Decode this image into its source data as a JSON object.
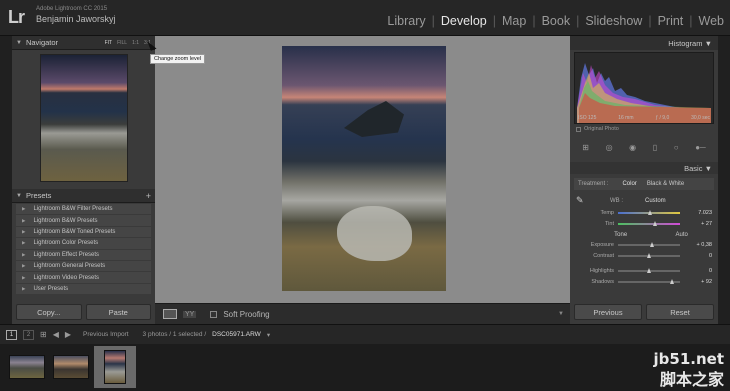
{
  "app": {
    "logo": "Lr",
    "name": "Adobe Lightroom CC 2015",
    "user": "Benjamin Jaworskyj"
  },
  "modules": [
    "Library",
    "Develop",
    "Map",
    "Book",
    "Slideshow",
    "Print",
    "Web"
  ],
  "active_module": "Develop",
  "navigator": {
    "title": "Navigator",
    "zoom_options": [
      "FIT",
      "FILL",
      "1:1",
      "3:1"
    ],
    "tooltip": "Change zoom level"
  },
  "presets": {
    "title": "Presets",
    "add": "+",
    "items": [
      "Lightroom B&W Filter Presets",
      "Lightroom B&W Presets",
      "Lightroom B&W Toned Presets",
      "Lightroom Color Presets",
      "Lightroom Effect Presets",
      "Lightroom General Presets",
      "Lightroom Video Presets",
      "User Presets"
    ]
  },
  "left_buttons": {
    "copy": "Copy...",
    "paste": "Paste"
  },
  "toolbar": {
    "yy": "YY",
    "soft_proofing": "Soft Proofing"
  },
  "histogram": {
    "title": "Histogram",
    "iso": "ISO 125",
    "focal": "16 mm",
    "aperture": "ƒ / 9,0",
    "shutter": "30,0 sec",
    "original_photo": "Original Photo"
  },
  "basic": {
    "title": "Basic",
    "treatment_label": "Treatment :",
    "treatment_color": "Color",
    "treatment_bw": "Black & White",
    "wb_label": "WB :",
    "wb_value": "Custom",
    "temp": {
      "label": "Temp",
      "value": "7.023"
    },
    "tint": {
      "label": "Tint",
      "value": "+ 27"
    },
    "tone_label": "Tone",
    "tone_auto": "Auto",
    "exposure": {
      "label": "Exposure",
      "value": "+ 0,38"
    },
    "contrast": {
      "label": "Contrast",
      "value": "0"
    },
    "highlights": {
      "label": "Highlights",
      "value": "0"
    },
    "shadows": {
      "label": "Shadows",
      "value": "+ 92"
    }
  },
  "right_buttons": {
    "previous": "Previous",
    "reset": "Reset"
  },
  "filmstrip": {
    "display1": "1",
    "display2": "2",
    "source": "Previous Import",
    "count": "3 photos / 1 selected /",
    "file": "DSC05971.ARW"
  },
  "watermark": {
    "url": "jb51.net",
    "cn": "脚本之家"
  }
}
